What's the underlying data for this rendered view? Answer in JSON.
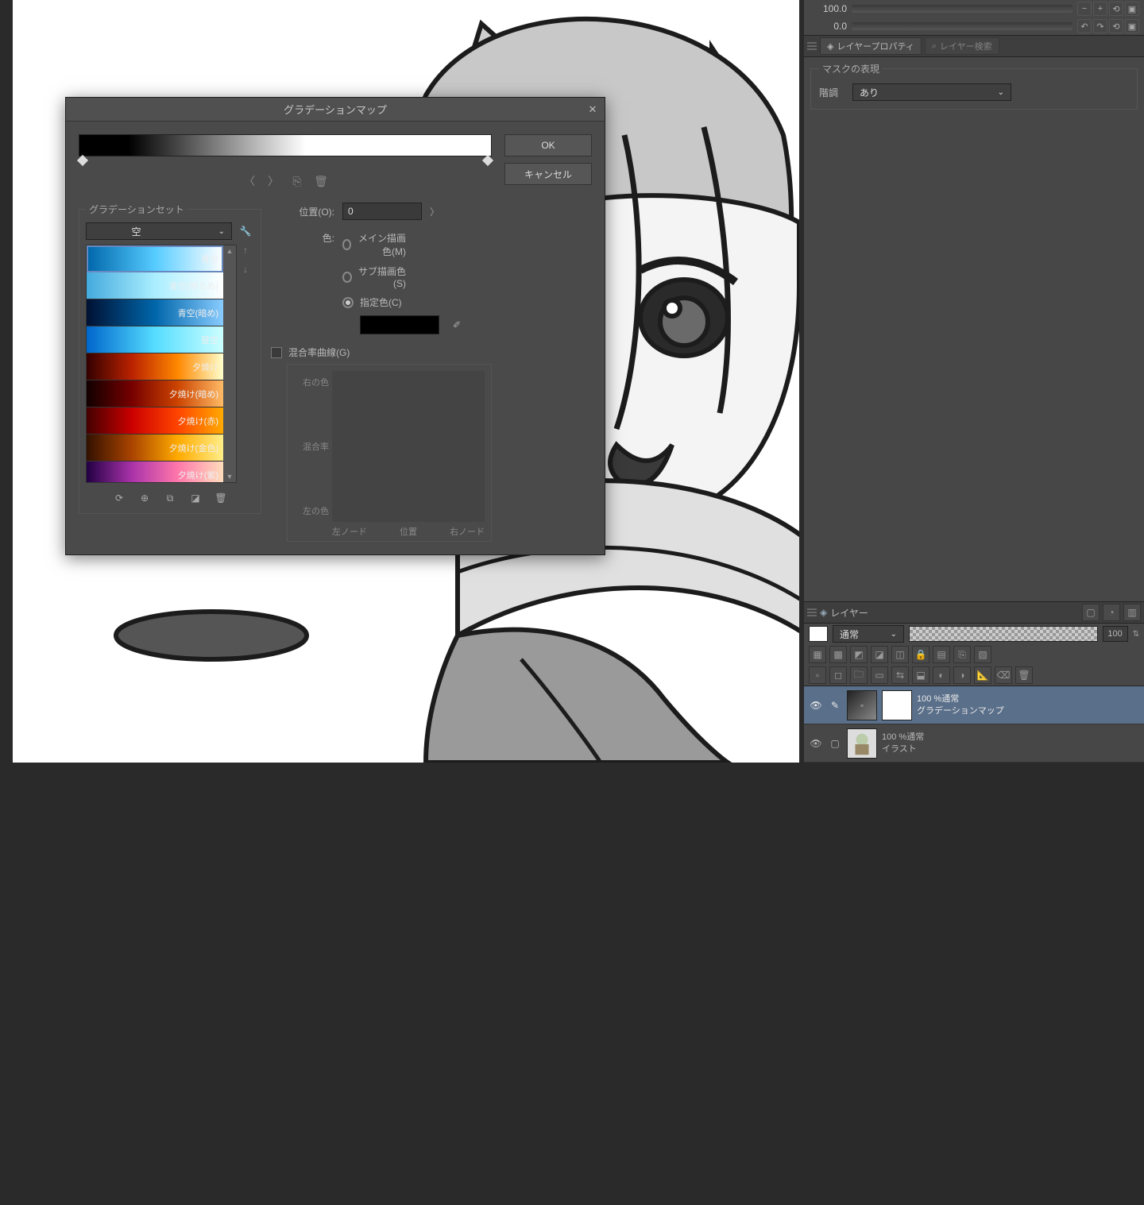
{
  "sliders": {
    "top": "100.0",
    "bottom": "0.0"
  },
  "tabs": {
    "layer_prop": "レイヤープロパティ",
    "layer_search": "レイヤー検索"
  },
  "mask": {
    "legend": "マスクの表現",
    "label": "階調",
    "value": "あり"
  },
  "layers_panel": {
    "title": "レイヤー",
    "blend_mode": "通常",
    "opacity": "100",
    "items": [
      {
        "line1": "100 %通常",
        "line2": "グラデーションマップ"
      },
      {
        "line1": "100 %通常",
        "line2": "イラスト"
      }
    ]
  },
  "dialog": {
    "title": "グラデーションマップ",
    "ok": "OK",
    "cancel": "キャンセル",
    "gset_label": "グラデーションセット",
    "gset_value": "空",
    "presets": [
      "青空",
      "青空(明るめ)",
      "青空(暗め)",
      "昼空",
      "夕焼け",
      "夕焼け(暗め)",
      "夕焼け(赤)",
      "夕焼け(金色)",
      "夕焼け(紫)"
    ],
    "position_label": "位置(O):",
    "position_value": "0",
    "color_label": "色:",
    "radios": {
      "main": "メイン描画色(M)",
      "sub": "サブ描画色(S)",
      "spec": "指定色(C)"
    },
    "mix_label": "混合率曲線(G)",
    "curve": {
      "right_color": "右の色",
      "mix": "混合率",
      "left_color": "左の色",
      "left_node": "左ノード",
      "pos": "位置",
      "right_node": "右ノード"
    }
  }
}
